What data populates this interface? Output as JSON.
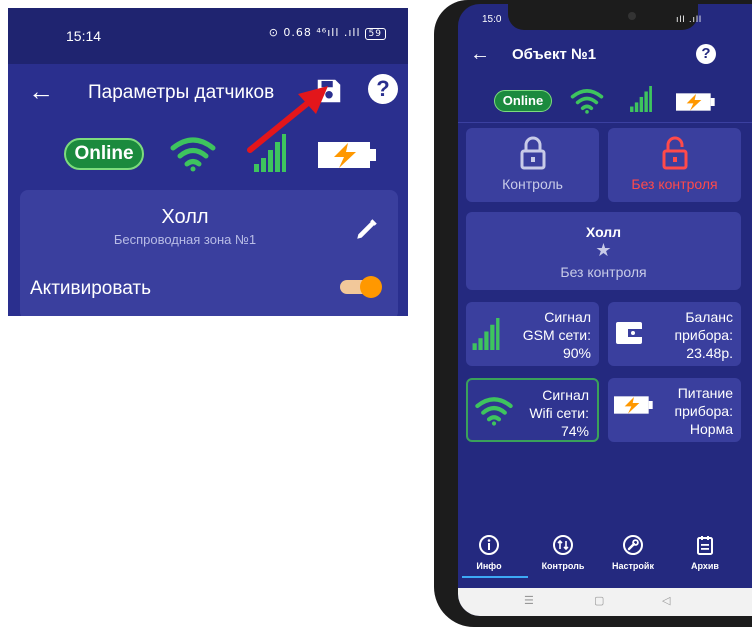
{
  "left": {
    "status": {
      "time": "15:14",
      "icons_text": "⊙ 0.68 ⁴⁶ıll .ıll",
      "battery": "59"
    },
    "appbar": {
      "title": "Параметры датчиков"
    },
    "status_row": {
      "online": "Online"
    },
    "sensor": {
      "name": "Холл",
      "zone": "Беспроводная зона №1",
      "activate_label": "Активировать",
      "activate_on": true
    }
  },
  "phone": {
    "status": {
      "time": "15:0",
      "icons_text": "ıll .ıll"
    },
    "appbar": {
      "title": "Объект №1"
    },
    "status_row": {
      "online": "Online"
    },
    "tiles": {
      "control": "Контроль",
      "no_control": "Без контроля",
      "holl_name": "Холл",
      "holl_state": "Без контроля",
      "gsm_text": [
        "Сигнал",
        "GSM сети:",
        "90%"
      ],
      "balance_text": [
        "Баланс",
        "прибора:",
        "23.48р."
      ],
      "wifi_text": [
        "Сигнал",
        "Wifi сети:",
        "74%"
      ],
      "power_text": [
        "Питание",
        "прибора:",
        "Норма"
      ]
    },
    "nav": {
      "info": "Инфо",
      "control": "Контроль",
      "settings": "Настройк",
      "archive": "Архив"
    },
    "colors": {
      "background": "#24297f",
      "tile": "#3a3f9e",
      "online_green": "#1b8a3e",
      "alert_red": "#ff4a4a",
      "toggle_orange": "#ff9800",
      "arrow_red": "#e3161b"
    }
  }
}
